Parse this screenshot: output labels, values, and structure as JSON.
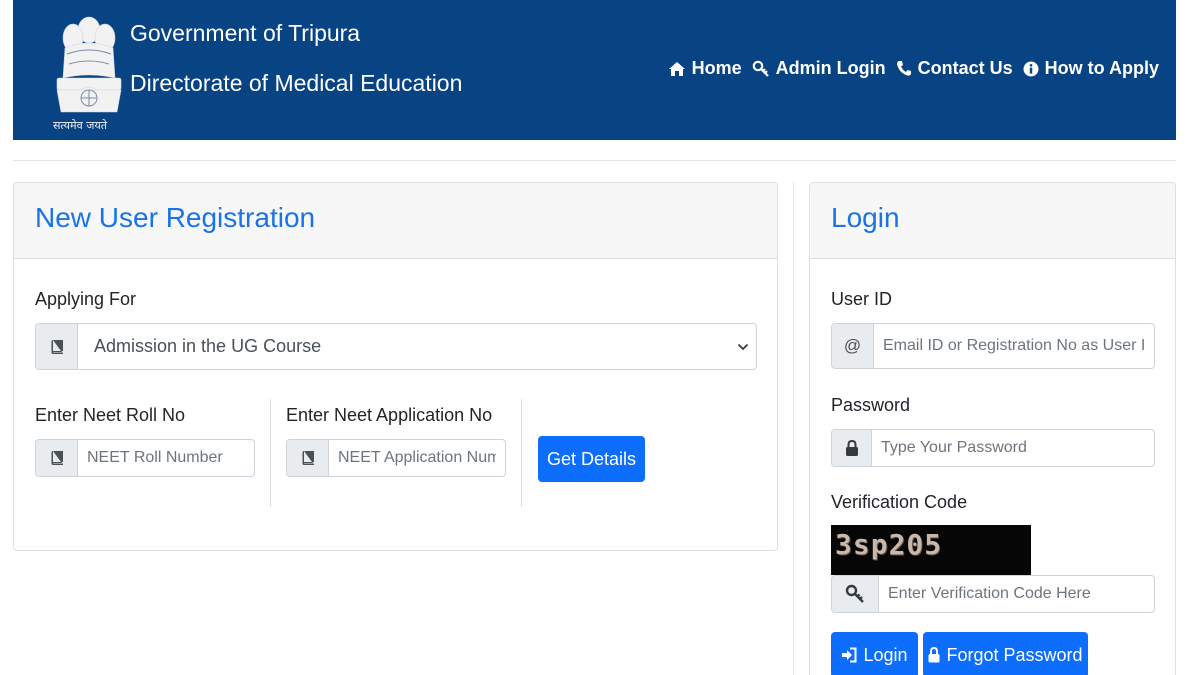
{
  "header": {
    "emblem_motto": "सत्यमेव जयते",
    "gov_title": "Government of Tripura",
    "dept_title": "Directorate of Medical Education",
    "nav": [
      {
        "label": "Home",
        "icon": "home-icon"
      },
      {
        "label": "Admin Login",
        "icon": "key-icon"
      },
      {
        "label": "Contact Us",
        "icon": "phone-icon"
      },
      {
        "label": "How to Apply",
        "icon": "info-icon"
      }
    ]
  },
  "registration": {
    "title": "New User Registration",
    "applying_for_label": "Applying For",
    "applying_for_value": "Admission in the UG Course",
    "neet_roll_label": "Enter Neet Roll No",
    "neet_roll_placeholder": "NEET Roll Number",
    "neet_app_label": "Enter Neet Application No",
    "neet_app_placeholder": "NEET Application Number",
    "get_details_label": "Get Details"
  },
  "login": {
    "title": "Login",
    "user_id_label": "User ID",
    "user_id_addon": "@",
    "user_id_placeholder": "Email ID or Registration No as User ID",
    "password_label": "Password",
    "password_placeholder": "Type Your Password",
    "verification_label": "Verification Code",
    "captcha_text": "3sp205",
    "verification_placeholder": "Enter Verification Code Here",
    "login_button": "Login",
    "forgot_button": "Forgot Password"
  },
  "colors": {
    "header_bg": "#084383",
    "accent": "#1a73e8",
    "button": "#0d6efd"
  }
}
